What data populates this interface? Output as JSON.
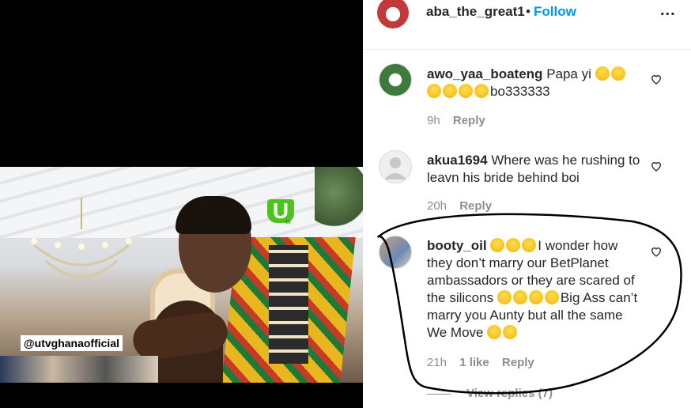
{
  "video": {
    "watermark_tag": "@utvghanaofficial",
    "logo_letter": "U",
    "logo_sub": "tv"
  },
  "header": {
    "username": "aba_the_great1",
    "separator": "•",
    "follow_label": "Follow",
    "more_label": "..."
  },
  "comments": [
    {
      "username": "awo_yaa_boateng",
      "text_line1": "Papa yi",
      "text_tail": "bo333333",
      "time": "9h",
      "reply_label": "Reply"
    },
    {
      "username": "akua1694",
      "text": "Where was he rushing to leavn his bride behind boi",
      "time": "20h",
      "reply_label": "Reply"
    },
    {
      "username": "booty_oil",
      "text_a": "I wonder how they don’t marry our BetPlanet ambassadors or they are scared of the silicons",
      "text_b": "Big Ass can’t marry you Aunty but all the same We Move",
      "time": "21h",
      "likes": "1 like",
      "reply_label": "Reply",
      "view_replies": "View replies (7)"
    }
  ],
  "colors": {
    "accent": "#0095f6",
    "muted": "#8e8e8e",
    "text": "#262626"
  }
}
